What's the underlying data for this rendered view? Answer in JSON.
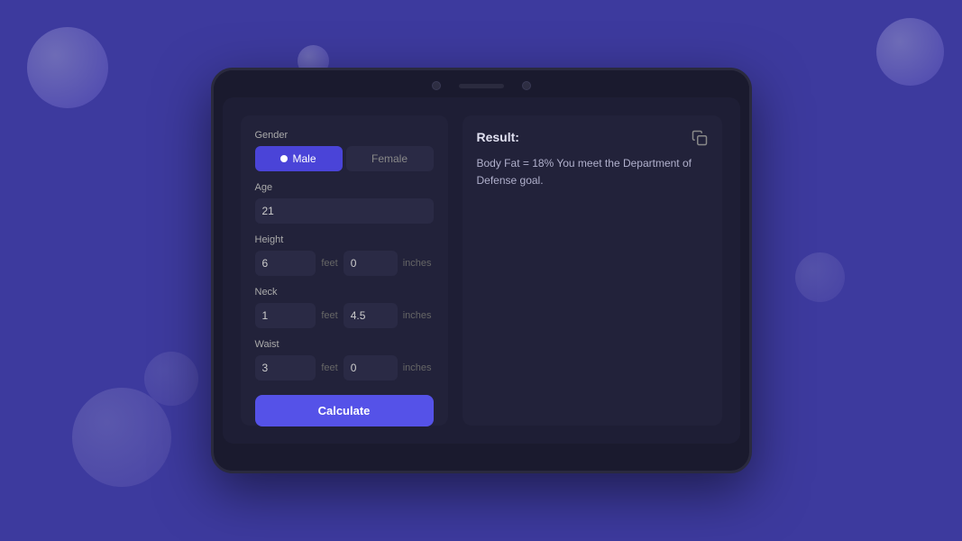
{
  "background": {
    "color": "#3d3a9e"
  },
  "tablet": {
    "form": {
      "gender_label": "Gender",
      "male_label": "Male",
      "female_label": "Female",
      "age_label": "Age",
      "age_value": "21",
      "height_label": "Height",
      "height_feet_value": "6",
      "height_feet_unit": "feet",
      "height_inches_value": "0",
      "height_inches_unit": "inches",
      "neck_label": "Neck",
      "neck_feet_value": "1",
      "neck_feet_unit": "feet",
      "neck_inches_value": "4.5",
      "neck_inches_unit": "inches",
      "waist_label": "Waist",
      "waist_feet_value": "3",
      "waist_feet_unit": "feet",
      "waist_inches_value": "0",
      "waist_inches_unit": "inches",
      "calculate_label": "Calculate"
    },
    "result": {
      "title": "Result:",
      "text": "Body Fat = 18% You meet the Department of Defense goal."
    }
  }
}
